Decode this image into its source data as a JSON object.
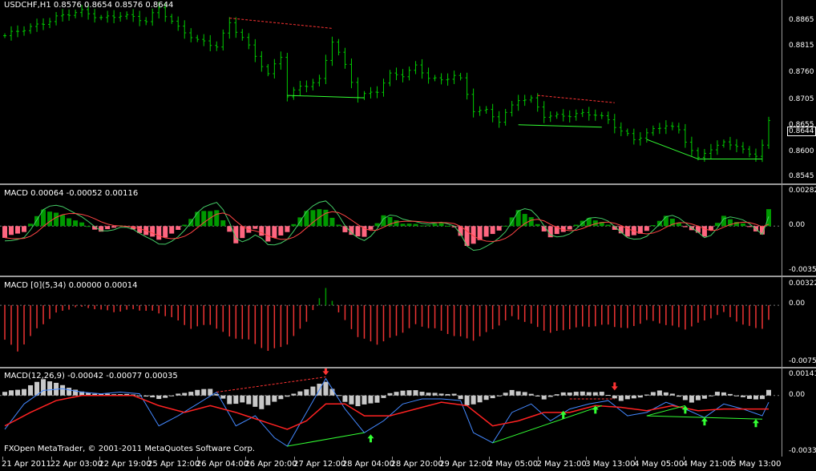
{
  "window": {
    "symbol_title": "USDCHF,H1  0.8576 0.8654 0.8576 0.8644",
    "copyright": "FXOpen MetaTrader, © 2001-2011 MetaQuotes Software Corp."
  },
  "panes": {
    "price": {
      "y_labels": [
        "0.8865",
        "0.8815",
        "0.8760",
        "0.8705",
        "0.8655",
        "0.8600",
        "0.8545"
      ],
      "current_price": "0.8644"
    },
    "macd1": {
      "title": "MACD 0.00064 -0.00052 0.00116",
      "y_labels": [
        "0.00282",
        "0.00",
        "-0.0035"
      ]
    },
    "macd2": {
      "title": "MACD [0](5,34) 0.00000 0.00014",
      "y_labels": [
        "0.00322",
        "0.00",
        "-0.00755"
      ]
    },
    "macd3": {
      "title": "MACD(12,26,9) -0.00042 -0.00077 0.00035",
      "y_labels": [
        "0.00141",
        "0.00",
        "-0.00333"
      ]
    }
  },
  "x_axis_labels": [
    "21 Apr 2011",
    "22 Apr 03:00",
    "22 Apr 19:00",
    "25 Apr 12:00",
    "26 Apr 04:00",
    "26 Apr 20:00",
    "27 Apr 12:00",
    "28 Apr 04:00",
    "28 Apr 20:00",
    "29 Apr 12:00",
    "2 May 05:00",
    "2 May 21:00",
    "3 May 13:00",
    "4 May 05:00",
    "4 May 21:00",
    "5 May 13:00"
  ],
  "colors": {
    "bars": "#00cc00",
    "divergence_bear": "#ff3333",
    "divergence_bull": "#33ff33",
    "hist_pos": "#009900",
    "hist_neg": "#ff6680",
    "hist2_neg": "#ee3333",
    "hist3": "#c8c8c8",
    "macd_line": "#4488ff",
    "signal_line": "#ff2222",
    "arrow_up": "#33ff33",
    "arrow_down": "#ff3333"
  },
  "chart_data": [
    {
      "type": "line",
      "pane": "price",
      "ylim": [
        0.852,
        0.8895
      ],
      "x_count": 120,
      "keypoints": [
        [
          0,
          0.882
        ],
        [
          4,
          0.884
        ],
        [
          8,
          0.886
        ],
        [
          12,
          0.887
        ],
        [
          15,
          0.886
        ],
        [
          18,
          0.8865
        ],
        [
          22,
          0.885
        ],
        [
          24,
          0.888
        ],
        [
          27,
          0.884
        ],
        [
          30,
          0.881
        ],
        [
          33,
          0.88
        ],
        [
          35,
          0.885
        ],
        [
          37,
          0.882
        ],
        [
          39,
          0.878
        ],
        [
          41,
          0.874
        ],
        [
          43,
          0.878
        ],
        [
          44,
          0.87
        ],
        [
          46,
          0.872
        ],
        [
          49,
          0.873
        ],
        [
          51,
          0.881
        ],
        [
          53,
          0.876
        ],
        [
          55,
          0.87
        ],
        [
          58,
          0.871
        ],
        [
          60,
          0.874
        ],
        [
          62,
          0.874
        ],
        [
          64,
          0.876
        ],
        [
          66,
          0.874
        ],
        [
          68,
          0.873
        ],
        [
          70,
          0.874
        ],
        [
          71,
          0.873
        ],
        [
          73,
          0.867
        ],
        [
          75,
          0.867
        ],
        [
          77,
          0.865
        ],
        [
          80,
          0.869
        ],
        [
          82,
          0.869
        ],
        [
          84,
          0.866
        ],
        [
          87,
          0.866
        ],
        [
          90,
          0.866
        ],
        [
          92,
          0.866
        ],
        [
          94,
          0.865
        ],
        [
          96,
          0.863
        ],
        [
          98,
          0.861
        ],
        [
          100,
          0.862
        ],
        [
          103,
          0.864
        ],
        [
          105,
          0.863
        ],
        [
          108,
          0.857
        ],
        [
          110,
          0.859
        ],
        [
          112,
          0.86
        ],
        [
          114,
          0.86
        ],
        [
          116,
          0.858
        ],
        [
          117,
          0.858
        ],
        [
          118,
          0.86
        ],
        [
          119,
          0.8644
        ]
      ],
      "divergence_lines": [
        {
          "kind": "bear",
          "from": [
            35,
            0.8858
          ],
          "to": [
            51,
            0.8837
          ]
        },
        {
          "kind": "bull",
          "from": [
            44,
            0.87
          ],
          "to": [
            56,
            0.8695
          ]
        },
        {
          "kind": "bear",
          "from": [
            83,
            0.87
          ],
          "to": [
            95,
            0.8685
          ]
        },
        {
          "kind": "bull",
          "from": [
            80,
            0.864
          ],
          "to": [
            93,
            0.8635
          ]
        },
        {
          "kind": "bull",
          "from": [
            100,
            0.861
          ],
          "to": [
            108,
            0.857
          ]
        },
        {
          "kind": "bull",
          "from": [
            108,
            0.857
          ],
          "to": [
            118,
            0.857
          ]
        }
      ]
    },
    {
      "type": "bar",
      "pane": "macd1",
      "ylim": [
        -0.0035,
        0.00282
      ],
      "keypoints": [
        [
          0,
          -0.0009
        ],
        [
          3,
          -0.0004
        ],
        [
          6,
          0.0013
        ],
        [
          9,
          0.0008
        ],
        [
          12,
          0.0002
        ],
        [
          15,
          -0.0004
        ],
        [
          18,
          0.0001
        ],
        [
          21,
          -0.0005
        ],
        [
          24,
          -0.001
        ],
        [
          27,
          -0.0003
        ],
        [
          30,
          0.001
        ],
        [
          33,
          0.0012
        ],
        [
          36,
          -0.0012
        ],
        [
          39,
          -0.0002
        ],
        [
          41,
          -0.0012
        ],
        [
          44,
          -0.0004
        ],
        [
          47,
          0.0012
        ],
        [
          50,
          0.0012
        ],
        [
          53,
          -0.0005
        ],
        [
          56,
          -0.0008
        ],
        [
          59,
          0.0008
        ],
        [
          62,
          0.0002
        ],
        [
          65,
          0.0001
        ],
        [
          68,
          0.0002
        ],
        [
          70,
          -0.0001
        ],
        [
          72,
          -0.0015
        ],
        [
          75,
          -0.0008
        ],
        [
          78,
          0.0
        ],
        [
          80,
          0.0012
        ],
        [
          82,
          0.0006
        ],
        [
          85,
          -0.0008
        ],
        [
          88,
          -0.0002
        ],
        [
          91,
          0.0006
        ],
        [
          94,
          0.0001
        ],
        [
          97,
          -0.0008
        ],
        [
          100,
          -0.0004
        ],
        [
          103,
          0.0008
        ],
        [
          106,
          0.0
        ],
        [
          109,
          -0.0008
        ],
        [
          112,
          0.0007
        ],
        [
          115,
          0.0002
        ],
        [
          118,
          -0.0006
        ],
        [
          119,
          0.0012
        ]
      ]
    },
    {
      "type": "bar",
      "pane": "macd2",
      "ylim": [
        -0.00755,
        0.00322
      ],
      "keypoints": [
        [
          0,
          -0.0045
        ],
        [
          2,
          -0.006
        ],
        [
          5,
          -0.003
        ],
        [
          8,
          -0.001
        ],
        [
          11,
          -0.0003
        ],
        [
          14,
          -0.0004
        ],
        [
          17,
          -0.0008
        ],
        [
          20,
          -0.0006
        ],
        [
          23,
          -0.0008
        ],
        [
          26,
          -0.0015
        ],
        [
          29,
          -0.003
        ],
        [
          32,
          -0.0025
        ],
        [
          35,
          -0.004
        ],
        [
          38,
          -0.0045
        ],
        [
          41,
          -0.006
        ],
        [
          44,
          -0.005
        ],
        [
          47,
          -0.002
        ],
        [
          50,
          0.0022
        ],
        [
          52,
          -0.001
        ],
        [
          55,
          -0.004
        ],
        [
          58,
          -0.005
        ],
        [
          61,
          -0.004
        ],
        [
          64,
          -0.0025
        ],
        [
          67,
          -0.003
        ],
        [
          70,
          -0.004
        ],
        [
          73,
          -0.0045
        ],
        [
          76,
          -0.003
        ],
        [
          79,
          -0.0015
        ],
        [
          82,
          -0.0025
        ],
        [
          85,
          -0.0035
        ],
        [
          88,
          -0.003
        ],
        [
          91,
          -0.0028
        ],
        [
          94,
          -0.0025
        ],
        [
          97,
          -0.003
        ],
        [
          100,
          -0.002
        ],
        [
          103,
          -0.0025
        ],
        [
          106,
          -0.003
        ],
        [
          109,
          -0.002
        ],
        [
          112,
          -0.001
        ],
        [
          115,
          -0.0025
        ],
        [
          118,
          -0.003
        ],
        [
          119,
          -0.002
        ]
      ]
    },
    {
      "type": "bar",
      "pane": "macd3",
      "ylim": [
        -0.00333,
        0.00141
      ],
      "keypoints": [
        [
          0,
          0.0002
        ],
        [
          3,
          0.0004
        ],
        [
          6,
          0.001
        ],
        [
          9,
          0.0006
        ],
        [
          12,
          0.0002
        ],
        [
          15,
          0.0001
        ],
        [
          18,
          0.0001
        ],
        [
          21,
          0.0
        ],
        [
          24,
          -0.0002
        ],
        [
          27,
          0.0001
        ],
        [
          30,
          0.0003
        ],
        [
          32,
          0.0004
        ],
        [
          35,
          -0.0005
        ],
        [
          37,
          -0.0004
        ],
        [
          40,
          -0.0008
        ],
        [
          43,
          -0.0002
        ],
        [
          47,
          0.0004
        ],
        [
          50,
          0.0008
        ],
        [
          53,
          -0.0004
        ],
        [
          55,
          -0.0006
        ],
        [
          58,
          -0.0004
        ],
        [
          60,
          0.0001
        ],
        [
          62,
          0.0003
        ],
        [
          64,
          0.0003
        ],
        [
          66,
          0.0002
        ],
        [
          68,
          0.0001
        ],
        [
          70,
          0.0001
        ],
        [
          72,
          -0.0006
        ],
        [
          74,
          -0.0004
        ],
        [
          77,
          0.0
        ],
        [
          79,
          0.0003
        ],
        [
          81,
          0.0002
        ],
        [
          84,
          -0.0002
        ],
        [
          87,
          0.0002
        ],
        [
          90,
          0.0002
        ],
        [
          93,
          0.0002
        ],
        [
          96,
          -0.0003
        ],
        [
          99,
          -0.0001
        ],
        [
          102,
          0.0003
        ],
        [
          104,
          0.0001
        ],
        [
          107,
          -0.0004
        ],
        [
          109,
          -0.0002
        ],
        [
          111,
          0.0002
        ],
        [
          113,
          0.0001
        ],
        [
          116,
          -0.0002
        ],
        [
          118,
          -0.0002
        ],
        [
          119,
          0.0003
        ]
      ],
      "macd_line_keypoints": [
        [
          0,
          -0.002
        ],
        [
          3,
          -0.0005
        ],
        [
          6,
          0.0003
        ],
        [
          9,
          0.0004
        ],
        [
          12,
          0.0002
        ],
        [
          15,
          0.0001
        ],
        [
          18,
          0.0002
        ],
        [
          21,
          0.0001
        ],
        [
          24,
          -0.0018
        ],
        [
          27,
          -0.0012
        ],
        [
          30,
          -0.0005
        ],
        [
          33,
          0.0002
        ],
        [
          36,
          -0.0018
        ],
        [
          39,
          -0.0012
        ],
        [
          42,
          -0.0025
        ],
        [
          44,
          -0.003
        ],
        [
          47,
          -0.001
        ],
        [
          50,
          0.001
        ],
        [
          53,
          -0.0008
        ],
        [
          56,
          -0.0022
        ],
        [
          59,
          -0.0015
        ],
        [
          62,
          -0.0005
        ],
        [
          65,
          -0.0002
        ],
        [
          68,
          -0.0002
        ],
        [
          71,
          -0.0003
        ],
        [
          73,
          -0.0022
        ],
        [
          76,
          -0.0028
        ],
        [
          79,
          -0.001
        ],
        [
          82,
          -0.0005
        ],
        [
          85,
          -0.0015
        ],
        [
          88,
          -0.0008
        ],
        [
          91,
          -0.0005
        ],
        [
          94,
          -0.0003
        ],
        [
          97,
          -0.0012
        ],
        [
          100,
          -0.001
        ],
        [
          103,
          -0.0004
        ],
        [
          106,
          -0.0008
        ],
        [
          109,
          -0.0013
        ],
        [
          112,
          -0.0005
        ],
        [
          115,
          -0.0008
        ],
        [
          118,
          -0.0012
        ],
        [
          119,
          -0.0004
        ]
      ],
      "signal_line_keypoints": [
        [
          0,
          -0.0018
        ],
        [
          4,
          -0.001
        ],
        [
          8,
          -0.0003
        ],
        [
          12,
          0.0
        ],
        [
          16,
          0.0
        ],
        [
          20,
          0.0
        ],
        [
          24,
          -0.0006
        ],
        [
          28,
          -0.001
        ],
        [
          32,
          -0.0006
        ],
        [
          36,
          -0.001
        ],
        [
          40,
          -0.0015
        ],
        [
          44,
          -0.002
        ],
        [
          47,
          -0.0015
        ],
        [
          50,
          -0.0005
        ],
        [
          53,
          -0.0005
        ],
        [
          56,
          -0.0012
        ],
        [
          60,
          -0.0012
        ],
        [
          64,
          -0.0008
        ],
        [
          68,
          -0.0004
        ],
        [
          72,
          -0.0006
        ],
        [
          76,
          -0.0018
        ],
        [
          80,
          -0.0015
        ],
        [
          84,
          -0.001
        ],
        [
          88,
          -0.001
        ],
        [
          92,
          -0.0006
        ],
        [
          96,
          -0.0007
        ],
        [
          100,
          -0.0009
        ],
        [
          104,
          -0.0006
        ],
        [
          108,
          -0.0009
        ],
        [
          112,
          -0.0008
        ],
        [
          116,
          -0.0008
        ],
        [
          119,
          -0.0008
        ]
      ],
      "divergence_lines": [
        {
          "kind": "bear",
          "from": [
            33,
            0.0002
          ],
          "to": [
            50,
            0.0011
          ]
        },
        {
          "kind": "bull",
          "from": [
            44,
            -0.003
          ],
          "to": [
            56,
            -0.0022
          ]
        },
        {
          "kind": "bull",
          "from": [
            76,
            -0.0028
          ],
          "to": [
            93,
            -0.0006
          ]
        },
        {
          "kind": "bear",
          "from": [
            88,
            -0.0002
          ],
          "to": [
            95,
            -0.0002
          ]
        },
        {
          "kind": "bull",
          "from": [
            100,
            -0.0012
          ],
          "to": [
            106,
            -0.0006
          ]
        },
        {
          "kind": "bull",
          "from": [
            100,
            -0.0012
          ],
          "to": [
            118,
            -0.0014
          ]
        }
      ],
      "arrows": [
        {
          "kind": "up",
          "x": 57,
          "y": -0.0023
        },
        {
          "kind": "up",
          "x": 87,
          "y": -0.0009
        },
        {
          "kind": "up",
          "x": 92,
          "y": -0.0006
        },
        {
          "kind": "up",
          "x": 106,
          "y": -0.0006
        },
        {
          "kind": "up",
          "x": 109,
          "y": -0.0013
        },
        {
          "kind": "up",
          "x": 117,
          "y": -0.0014
        },
        {
          "kind": "down",
          "x": 50,
          "y": 0.0012
        },
        {
          "kind": "down",
          "x": 95,
          "y": 0.0003
        }
      ]
    }
  ]
}
